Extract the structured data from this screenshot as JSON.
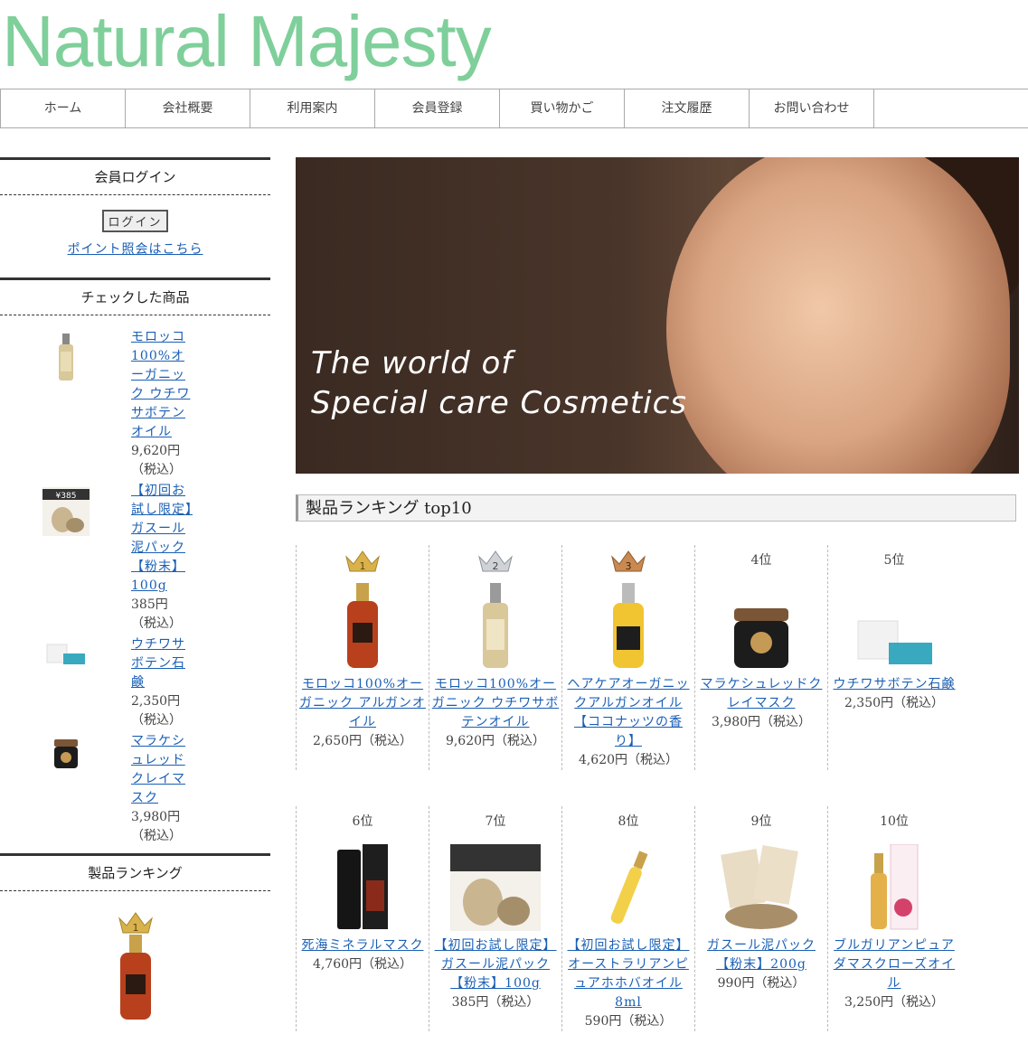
{
  "logo": "Natural Majesty",
  "nav": [
    "ホーム",
    "会社概要",
    "利用案内",
    "会員登録",
    "買い物かご",
    "注文履歴",
    "お問い合わせ"
  ],
  "sidebar": {
    "login_title": "会員ログイン",
    "login_button": "ログイン",
    "point_link": "ポイント照会はこちら",
    "checked_title": "チェックした商品",
    "checked_items": [
      {
        "name": "モロッコ100%オーガニック ウチワサボテンオイル",
        "price": "9,620円",
        "tax": "（税込）"
      },
      {
        "name": "【初回お試し限定】ガスール泥パック【粉末】100g",
        "price": "385円",
        "tax": "（税込）"
      },
      {
        "name": "ウチワサボテン石鹸",
        "price": "2,350円",
        "tax": "（税込）"
      },
      {
        "name": "マラケシュレッドクレイマスク",
        "price": "3,980円",
        "tax": "（税込）"
      }
    ],
    "ranking_title": "製品ランキング"
  },
  "banner": {
    "line1": "The world of",
    "line2": "Special care Cosmetics"
  },
  "ranking": {
    "title": "製品ランキング top10",
    "items": [
      {
        "rank": "1",
        "name": "モロッコ100%オーガニック アルガンオイル",
        "price": "2,650円（税込）"
      },
      {
        "rank": "2",
        "name": "モロッコ100%オーガニック ウチワサボテンオイル",
        "price": "9,620円（税込）"
      },
      {
        "rank": "3",
        "name": "ヘアケアオーガニックアルガンオイル【ココナッツの香り】",
        "price": "4,620円（税込）"
      },
      {
        "rank": "4位",
        "name": "マラケシュレッドクレイマスク",
        "price": "3,980円（税込）"
      },
      {
        "rank": "5位",
        "name": "ウチワサボテン石鹸",
        "price": "2,350円（税込）"
      },
      {
        "rank": "6位",
        "name": "死海ミネラルマスク",
        "price": "4,760円（税込）"
      },
      {
        "rank": "7位",
        "name": "【初回お試し限定】ガスール泥パック【粉末】100g",
        "price": "385円（税込）"
      },
      {
        "rank": "8位",
        "name": "【初回お試し限定】オーストラリアンピュアホホバオイル8ml",
        "price": "590円（税込）"
      },
      {
        "rank": "9位",
        "name": "ガスール泥パック【粉末】200g",
        "price": "990円（税込）"
      },
      {
        "rank": "10位",
        "name": "ブルガリアンピュアダマスクローズオイル",
        "price": "3,250円（税込）"
      }
    ]
  },
  "colors": {
    "logo": "#7fcf9a",
    "link": "#1a5fb4"
  }
}
